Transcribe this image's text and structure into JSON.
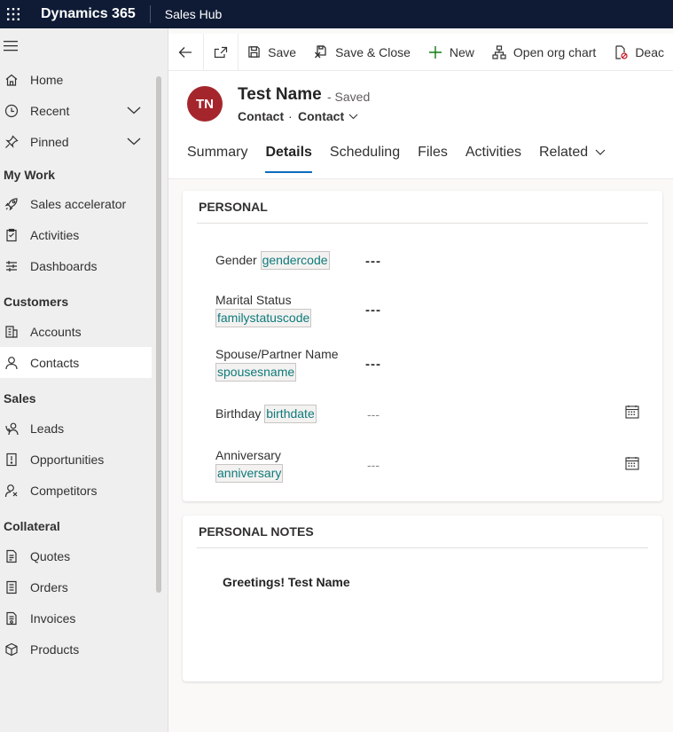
{
  "topbar": {
    "app_name": "Dynamics 365",
    "module": "Sales Hub"
  },
  "sidebar": {
    "items_top": [
      {
        "label": "Home",
        "icon": "home-icon",
        "chevron": false
      },
      {
        "label": "Recent",
        "icon": "clock-icon",
        "chevron": true
      },
      {
        "label": "Pinned",
        "icon": "pin-icon",
        "chevron": true
      }
    ],
    "sections": [
      {
        "title": "My Work",
        "items": [
          {
            "label": "Sales accelerator",
            "icon": "rocket-icon"
          },
          {
            "label": "Activities",
            "icon": "clipboard-icon"
          },
          {
            "label": "Dashboards",
            "icon": "dashboard-icon"
          }
        ]
      },
      {
        "title": "Customers",
        "items": [
          {
            "label": "Accounts",
            "icon": "building-icon"
          },
          {
            "label": "Contacts",
            "icon": "person-icon",
            "active": true
          }
        ]
      },
      {
        "title": "Sales",
        "items": [
          {
            "label": "Leads",
            "icon": "phone-person-icon"
          },
          {
            "label": "Opportunities",
            "icon": "opportunity-icon"
          },
          {
            "label": "Competitors",
            "icon": "competitor-icon"
          }
        ]
      },
      {
        "title": "Collateral",
        "items": [
          {
            "label": "Quotes",
            "icon": "quote-doc-icon"
          },
          {
            "label": "Orders",
            "icon": "order-doc-icon"
          },
          {
            "label": "Invoices",
            "icon": "invoice-doc-icon"
          },
          {
            "label": "Products",
            "icon": "cube-icon"
          }
        ]
      }
    ]
  },
  "commandbar": {
    "save": "Save",
    "save_close": "Save & Close",
    "new": "New",
    "org_chart": "Open org chart",
    "deactivate": "Deac"
  },
  "record": {
    "initials": "TN",
    "avatar_color": "#a4262c",
    "title": "Test Name",
    "status": "- Saved",
    "entity": "Contact",
    "separator": "·",
    "form": "Contact"
  },
  "tabs": [
    "Summary",
    "Details",
    "Scheduling",
    "Files",
    "Activities",
    "Related"
  ],
  "active_tab": "Details",
  "personal": {
    "title": "PERSONAL",
    "fields": [
      {
        "label": "Gender",
        "tag": "gendercode",
        "value": "---"
      },
      {
        "label": "Marital Status",
        "tag": "familystatuscode",
        "value": "---"
      },
      {
        "label": "Spouse/Partner Name",
        "tag": "spousesname",
        "value": "---"
      },
      {
        "label": "Birthday",
        "tag": "birthdate",
        "value": "---"
      },
      {
        "label": "Anniversary",
        "tag": "anniversary",
        "value": "---"
      }
    ]
  },
  "notes": {
    "title": "PERSONAL NOTES",
    "text": "Greetings! Test Name"
  },
  "colors": {
    "topbar": "#0f1b35",
    "accent": "#0f6cbd",
    "tag_text": "#0f7a7a"
  }
}
